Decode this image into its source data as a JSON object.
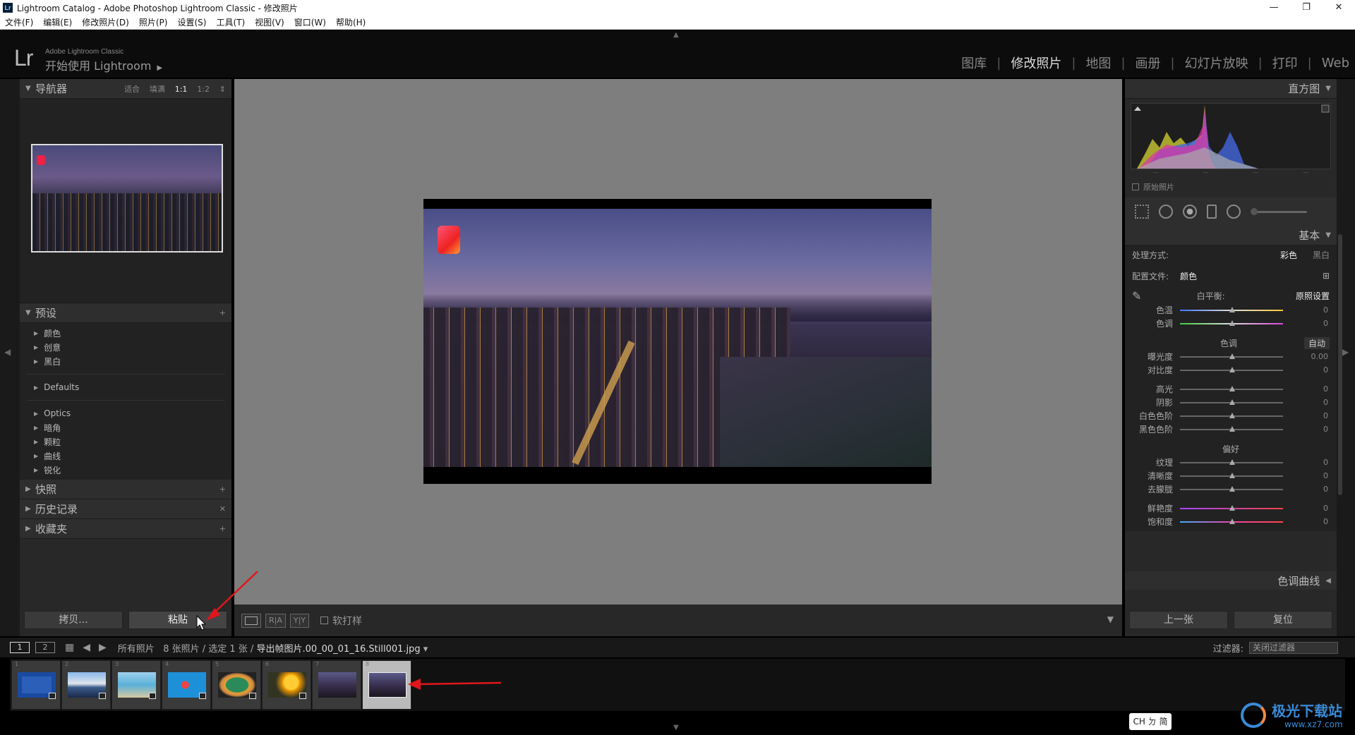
{
  "window": {
    "title": "Lightroom Catalog - Adobe Photoshop Lightroom Classic - 修改照片",
    "app_icon": "Lr",
    "controls": [
      "—",
      "❐",
      "✕"
    ]
  },
  "menu": [
    "文件(F)",
    "编辑(E)",
    "修改照片(D)",
    "照片(P)",
    "设置(S)",
    "工具(T)",
    "视图(V)",
    "窗口(W)",
    "帮助(H)"
  ],
  "header": {
    "logo": "Lr",
    "subtitle": "Adobe Lightroom Classic",
    "identity": "开始使用 Lightroom",
    "modules": [
      "图库",
      "修改照片",
      "地图",
      "画册",
      "幻灯片放映",
      "打印",
      "Web"
    ],
    "active_module": "修改照片"
  },
  "left_panel": {
    "navigator": {
      "title": "导航器",
      "zoom_options": [
        "适合",
        "填满",
        "1:1",
        "1:2"
      ],
      "selected_zoom": "1:1"
    },
    "presets": {
      "title": "预设",
      "groups_a": [
        "颜色",
        "创意",
        "黑白"
      ],
      "groups_b": [
        "Defaults"
      ],
      "groups_c": [
        "Optics",
        "暗角",
        "颗粒",
        "曲线",
        "锐化"
      ]
    },
    "snapshots": {
      "title": "快照"
    },
    "history": {
      "title": "历史记录"
    },
    "collections": {
      "title": "收藏夹"
    },
    "copy_label": "拷贝...",
    "paste_label": "粘贴"
  },
  "toolbar": {
    "before_after_1": "R|A",
    "before_after_2": "Y|Y",
    "soft_proof": "软打样"
  },
  "right_panel": {
    "histogram": {
      "title": "直方图",
      "original_photo": "原始照片"
    },
    "basic": {
      "title": "基本",
      "treatment_label": "处理方式:",
      "treatment_options": [
        "彩色",
        "黑白"
      ],
      "profile_label": "配置文件:",
      "profile_value": "颜色",
      "wb_label": "白平衡:",
      "wb_value": "原照设置",
      "temp": {
        "label": "色温",
        "value": "0"
      },
      "tint": {
        "label": "色调",
        "value": "0"
      },
      "tone_label": "色调",
      "auto": "自动",
      "exposure": {
        "label": "曝光度",
        "value": "0.00"
      },
      "contrast": {
        "label": "对比度",
        "value": "0"
      },
      "highlights": {
        "label": "高光",
        "value": "0"
      },
      "shadows": {
        "label": "阴影",
        "value": "0"
      },
      "whites": {
        "label": "白色色阶",
        "value": "0"
      },
      "blacks": {
        "label": "黑色色阶",
        "value": "0"
      },
      "presence_label": "偏好",
      "texture": {
        "label": "纹理",
        "value": "0"
      },
      "clarity": {
        "label": "清晰度",
        "value": "0"
      },
      "dehaze": {
        "label": "去朦胧",
        "value": "0"
      },
      "vibrance": {
        "label": "鲜艳度",
        "value": "0"
      },
      "saturation": {
        "label": "饱和度",
        "value": "0"
      }
    },
    "tone_curve": {
      "title": "色调曲线"
    },
    "prev_label": "上一张",
    "reset_label": "复位"
  },
  "filmstrip": {
    "views": [
      "1",
      "2"
    ],
    "source": "所有照片",
    "count": "8 张照片 / 选定 1 张 /",
    "file": "导出帧图片.00_00_01_16.Still001.jpg",
    "filter_label": "过滤器:",
    "filter_value": "关闭过滤器",
    "thumbs": [
      "1",
      "2",
      "3",
      "4",
      "5",
      "6",
      "7",
      "8"
    ]
  },
  "ime": "CH ㄉ 简",
  "watermark": {
    "name": "极光下载站",
    "url": "www.xz7.com"
  },
  "colors": {
    "accent_arrow": "#e0161c",
    "panel": "#282828",
    "canvas": "#7e7e7e"
  }
}
